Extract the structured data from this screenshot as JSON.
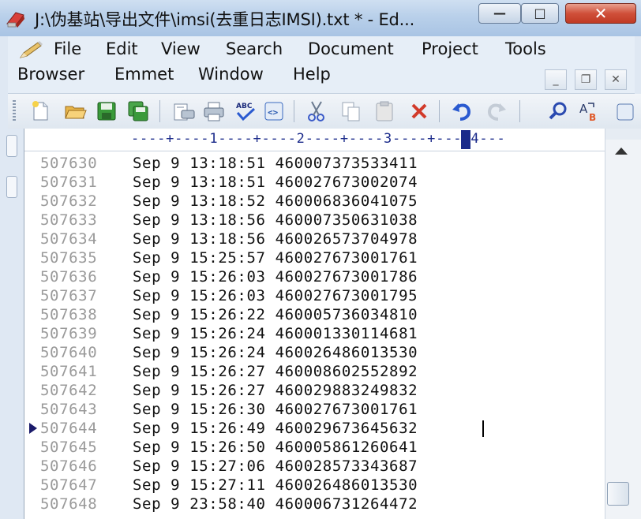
{
  "window": {
    "title": "J:\\伪基站\\导出文件\\imsi(去重日志IMSI).txt * - Ed...",
    "controls": {
      "minimize": "—",
      "maximize": "□",
      "close": "✕"
    }
  },
  "menu": {
    "row1": [
      "File",
      "Edit",
      "View",
      "Search",
      "Document",
      "Project",
      "Tools"
    ],
    "row2": [
      "Browser",
      "Emmet",
      "Window",
      "Help"
    ],
    "mdi_controls": {
      "minimize": "_",
      "restore": "❐",
      "close": "✕"
    }
  },
  "toolbar": {
    "buttons": [
      "new-file",
      "open-file",
      "save",
      "save-all",
      "print-preview",
      "print",
      "spell-check",
      "html-validate",
      "cut",
      "copy",
      "paste",
      "delete",
      "undo",
      "redo",
      "find",
      "replace"
    ]
  },
  "ruler": {
    "text": "----+----1----+----2----+----3----+----4---"
  },
  "editor": {
    "current_line": "507644",
    "lines": [
      {
        "num": "507630",
        "text": "Sep 9 13:18:51 460007373533411"
      },
      {
        "num": "507631",
        "text": "Sep 9 13:18:51 460027673002074"
      },
      {
        "num": "507632",
        "text": "Sep 9 13:18:52 460006836041075"
      },
      {
        "num": "507633",
        "text": "Sep 9 13:18:56 460007350631038"
      },
      {
        "num": "507634",
        "text": "Sep 9 13:18:56 460026573704978"
      },
      {
        "num": "507635",
        "text": "Sep 9 15:25:57 460027673001761"
      },
      {
        "num": "507636",
        "text": "Sep 9 15:26:03 460027673001786"
      },
      {
        "num": "507637",
        "text": "Sep 9 15:26:03 460027673001795"
      },
      {
        "num": "507638",
        "text": "Sep 9 15:26:22 460005736034810"
      },
      {
        "num": "507639",
        "text": "Sep 9 15:26:24 460001330114681"
      },
      {
        "num": "507640",
        "text": "Sep 9 15:26:24 460026486013530"
      },
      {
        "num": "507641",
        "text": "Sep 9 15:26:27 460008602552892"
      },
      {
        "num": "507642",
        "text": "Sep 9 15:26:27 460029883249832"
      },
      {
        "num": "507643",
        "text": "Sep 9 15:26:30 460027673001761"
      },
      {
        "num": "507644",
        "text": "Sep 9 15:26:49 460029673645632"
      },
      {
        "num": "507645",
        "text": "Sep 9 15:26:50 460005861260641"
      },
      {
        "num": "507646",
        "text": "Sep 9 15:27:06 460028573343687"
      },
      {
        "num": "507647",
        "text": "Sep 9 15:27:11 460026486013530"
      },
      {
        "num": "507648",
        "text": "Sep 9 23:58:40 460006731264472"
      }
    ]
  }
}
